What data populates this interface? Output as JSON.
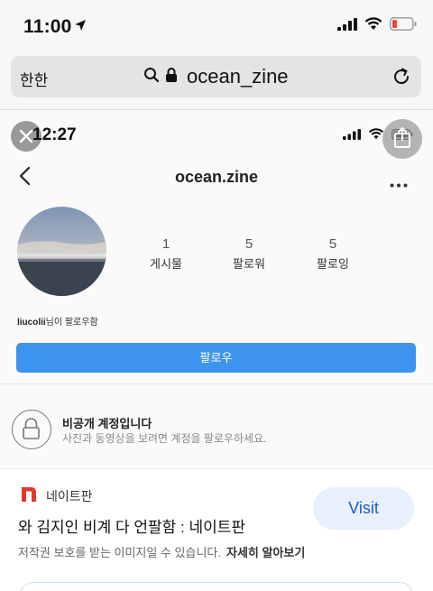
{
  "status_bar": {
    "time": "11:00"
  },
  "url_bar": {
    "aa_label": "한한",
    "url": "ocean_zine"
  },
  "screenshot": {
    "status_time": "12:27",
    "profile": {
      "username": "ocean.zine",
      "stats": [
        {
          "value": "1",
          "label": "게시물"
        },
        {
          "value": "5",
          "label": "팔로워"
        },
        {
          "value": "5",
          "label": "팔로잉"
        }
      ],
      "followed_by_user": "liucolii",
      "followed_by_suffix": "님이 팔로우함",
      "follow_button": "팔로우",
      "private_title": "비공개 계정입니다",
      "private_subtitle": "사진과 동영상을 보려면 계정을 팔로우하세요."
    }
  },
  "search_result": {
    "site_name": "네이트판",
    "title": "와 김지인 비계 다 언팔함 : 네이트판",
    "visit_button": "Visit",
    "copyright_note": "저작권 보호를 받는 이미지일 수 있습니다.",
    "learn_more": "자세히 알아보기"
  },
  "colors": {
    "accent_blue": "#3d94f0",
    "visit_bg": "#e8f0fe",
    "visit_text": "#1a5bbf",
    "nate_red": "#e8342a",
    "battery_red": "#e8463c"
  },
  "icons": [
    "location-arrow-icon",
    "signal-icon",
    "wifi-icon",
    "battery-icon",
    "search-icon",
    "lock-icon",
    "reload-icon",
    "close-icon",
    "share-icon",
    "back-arrow-icon",
    "more-dots-icon",
    "private-lock-icon",
    "nate-logo-icon"
  ]
}
